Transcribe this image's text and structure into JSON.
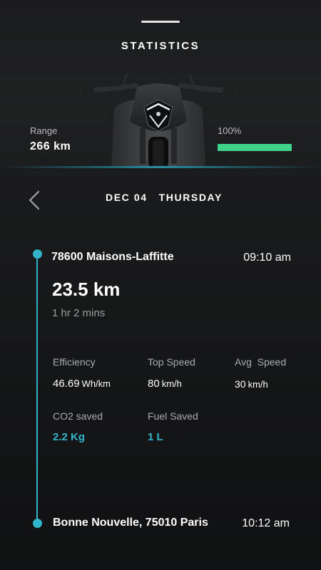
{
  "header": {
    "title": "STATISTICS",
    "range_label": "Range",
    "range_value": "266 km",
    "battery_label": "100%",
    "battery_level": 1.0
  },
  "trip": {
    "date": "DEC 04",
    "weekday": "THURSDAY",
    "start_location": "78600 Maisons-Laffitte",
    "start_time": "09:10 am",
    "distance": "23.5 km",
    "duration": "1 hr 2 mins",
    "end_location": "Bonne Nouvelle, 75010 Paris",
    "end_time": "10:12 am"
  },
  "stats": {
    "efficiency": {
      "label": "Efficiency",
      "value": "46.69",
      "unit": "Wh/km"
    },
    "top_speed": {
      "label": "Top Speed",
      "value": "80",
      "unit": "km/h"
    },
    "avg_speed": {
      "label": "Avg  Speed",
      "value": "30",
      "unit": "km/h"
    },
    "co2": {
      "label": "CO2 saved",
      "value": "2.2 Kg"
    },
    "fuel": {
      "label": "Fuel Saved",
      "value": "1 L"
    }
  },
  "colors": {
    "accent": "#2fb4c9",
    "battery": "#3fd38a",
    "background": "#121314"
  },
  "icons": {
    "back": "chevron-left-icon",
    "bike": "motorcycle-image"
  }
}
